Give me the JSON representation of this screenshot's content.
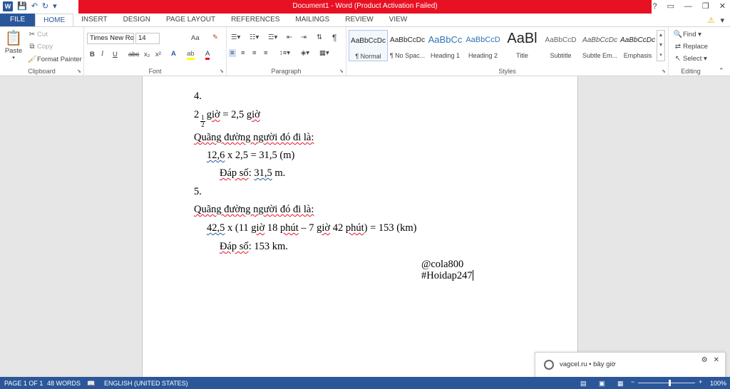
{
  "window": {
    "title": "Document1 - Word (Product Activation Failed)",
    "app_icon": "W",
    "controls": [
      "?",
      "▭",
      "—",
      "❐",
      "✕"
    ]
  },
  "tabs": [
    "FILE",
    "HOME",
    "INSERT",
    "DESIGN",
    "PAGE LAYOUT",
    "REFERENCES",
    "MAILINGS",
    "REVIEW",
    "VIEW"
  ],
  "ribbon": {
    "clipboard": {
      "paste": "Paste",
      "cut": "Cut",
      "copy": "Copy",
      "format_painter": "Format Painter",
      "label": "Clipboard"
    },
    "font": {
      "name": "Times New Ro",
      "size": "14",
      "label": "Font",
      "bold": "B",
      "italic": "I",
      "underline": "U",
      "strike": "abc",
      "sub": "x₂",
      "sup": "x²",
      "grow": "Aa"
    },
    "paragraph": {
      "label": "Paragraph",
      "pilcrow": "¶"
    },
    "styles": {
      "label": "Styles",
      "items": [
        {
          "preview": "AaBbCcDc",
          "name": "¶ Normal"
        },
        {
          "preview": "AaBbCcDc",
          "name": "¶ No Spac..."
        },
        {
          "preview": "AaBbCc",
          "name": "Heading 1"
        },
        {
          "preview": "AaBbCcD",
          "name": "Heading 2"
        },
        {
          "preview": "AaBl",
          "name": "Title"
        },
        {
          "preview": "AaBbCcD",
          "name": "Subtitle"
        },
        {
          "preview": "AaBbCcDc",
          "name": "Subtle Em..."
        },
        {
          "preview": "AaBbCcDc",
          "name": "Emphasis"
        }
      ]
    },
    "editing": {
      "find": "Find",
      "replace": "Replace",
      "select": "Select",
      "label": "Editing"
    }
  },
  "document": {
    "l1": "4.",
    "l2_whole": "2",
    "l2_num": "1",
    "l2_den": "2",
    "l2_a": "giờ",
    "l2_b": " = 2,5 ",
    "l2_c": "giờ",
    "l3": "Quãng đường người đó đi là:",
    "l4_a": "12,6",
    "l4_b": " x 2,5 = 31,5 (m)",
    "l5_a": "Đáp số",
    "l5_b": ": ",
    "l5_c": "31,5",
    "l5_d": " m.",
    "l6": "5.",
    "l7": "Quãng đường người đó đi là:",
    "l8_a": "42,5",
    "l8_b": " x (11 ",
    "l8_c": "giờ",
    "l8_d": " 18 ",
    "l8_e": "phút",
    "l8_f": " – 7 ",
    "l8_g": "giờ",
    "l8_h": " 42 ",
    "l8_i": "phút",
    "l8_j": ") = 153 (km)",
    "l9_a": "Đáp số",
    "l9_b": ": 153 km.",
    "sig1": "@cola800",
    "sig2": "#Hoidap247"
  },
  "notification": {
    "text": "vagcel.ru  •  bây giờ"
  },
  "status": {
    "page": "PAGE 1 OF 1",
    "words": "48 WORDS",
    "language": "ENGLISH (UNITED STATES)",
    "zoom": "100%"
  },
  "colors": {
    "accent": "#2b579a",
    "title_bar": "#e81123"
  }
}
